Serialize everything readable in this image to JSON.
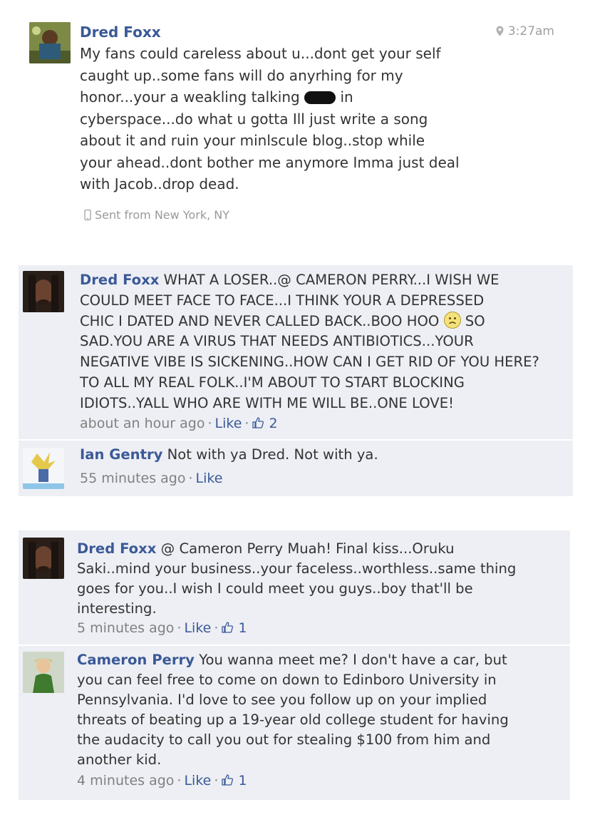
{
  "post": {
    "author": "Dred Foxx",
    "time": "3:27am",
    "lines": [
      "My fans could careless about u...dont get your self",
      "caught up..some fans will do anyrhing for my",
      "honor...your a weakling talking",
      "in",
      "cyberspace...do what u gotta Ill just write a song",
      "about it and ruin your minlscule blog..stop while",
      "your ahead..dont bother me anymore Imma just deal",
      "with Jacob..drop dead."
    ],
    "sent_from": "Sent from New York, NY"
  },
  "thread1": [
    {
      "author": "Dred Foxx",
      "lines": [
        "WHAT A LOSER..@ CAMERON PERRY...I WISH WE",
        "COULD MEET FACE TO FACE...I THINK YOUR A DEPRESSED",
        "CHIC I DATED AND NEVER CALLED BACK..BOO HOO",
        "SO",
        "SAD.YOU ARE A VIRUS THAT NEEDS ANTIBIOTICS...YOUR",
        "NEGATIVE VIBE IS SICKENING..HOW CAN I GET RID OF YOU HERE?",
        "TO ALL MY REAL FOLK..I'M ABOUT TO START BLOCKING",
        "IDIOTS..YALL WHO ARE WITH ME WILL BE..ONE LOVE!"
      ],
      "time": "about an hour ago",
      "like_label": "Like",
      "like_count": "2"
    },
    {
      "author": "Ian Gentry",
      "lines": [
        "Not with ya Dred. Not with ya."
      ],
      "time": "55 minutes ago",
      "like_label": "Like"
    }
  ],
  "thread2": [
    {
      "author": "Dred Foxx",
      "lines": [
        "@ Cameron Perry Muah! Final kiss...Oruku",
        "Saki..mind your business..your faceless..worthless..same thing",
        "goes for you..I wish I could meet you guys..boy that'll be",
        "interesting."
      ],
      "time": "5 minutes ago",
      "like_label": "Like",
      "like_count": "1"
    },
    {
      "author": "Cameron Perry",
      "lines": [
        "You wanna meet me? I don't have a car, but",
        "you can feel free to come on down to Edinboro University in",
        "Pennsylvania. I'd love to see you follow up on your implied",
        "threats of beating up a 19-year old college student for having",
        "the audacity to call you out for stealing $100 from him and",
        "another kid."
      ],
      "time": "4 minutes ago",
      "like_label": "Like",
      "like_count": "1"
    }
  ],
  "separator": "·",
  "colors": {
    "link": "#3b5998",
    "bg": "#edeff4",
    "meta": "#808080"
  }
}
